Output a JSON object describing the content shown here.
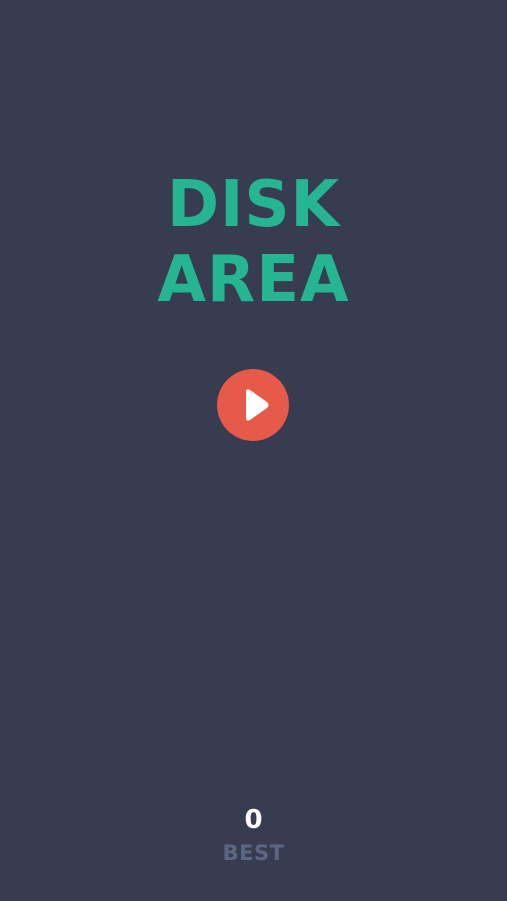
{
  "game": {
    "title_line_1": "DISK",
    "title_line_2": "AREA"
  },
  "play": {
    "icon": "play-icon"
  },
  "score": {
    "best_value": "0",
    "best_label": "BEST"
  },
  "colors": {
    "background": "#373c50",
    "title": "#25b593",
    "play_button": "#e65a4a",
    "score_value": "#ffffff",
    "score_label": "#5c6683"
  }
}
